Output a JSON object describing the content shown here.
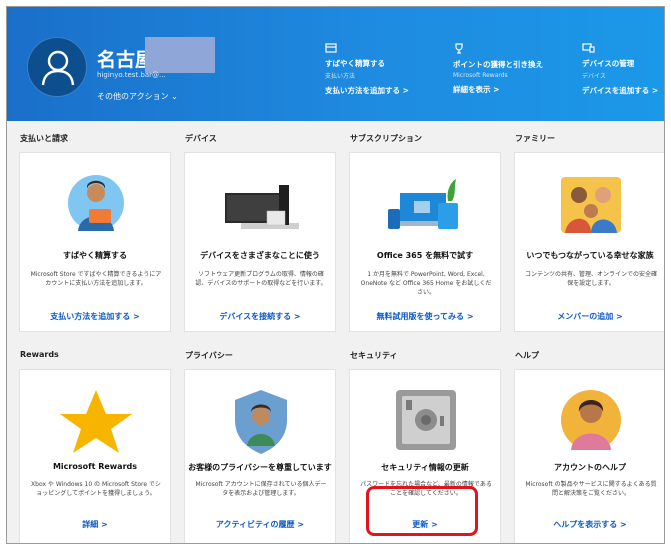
{
  "header": {
    "user_name": "名古屋",
    "user_email": "higinyo.test.bar@...",
    "other_actions": "その他のアクション ⌄",
    "quick_actions": [
      {
        "icon": "card-icon",
        "title": "すばやく精算する",
        "sub": "支払い方法",
        "link": "支払い方法を追加する >"
      },
      {
        "icon": "trophy-icon",
        "title": "ポイントの獲得と引き換え",
        "sub": "Microsoft Rewards",
        "link": "詳細を表示 >"
      },
      {
        "icon": "devices-icon",
        "title": "デバイスの管理",
        "sub": "デバイス",
        "link": "デバイスを追加する >"
      }
    ]
  },
  "sections": [
    {
      "label": "支払いと請求",
      "title": "すばやく精算する",
      "desc": "Microsoft Store ですばやく精算できるようにアカウントに支払い方法を追加します。",
      "link": "支払い方法を追加する >"
    },
    {
      "label": "デバイス",
      "title": "デバイスをさまざまなことに使う",
      "desc": "ソフトウェア更新プログラムの取得、情報の確認、デバイスのサポートの取得などを行います。",
      "link": "デバイスを接続する >"
    },
    {
      "label": "サブスクリプション",
      "title": "Office 365 を無料で試す",
      "desc": "1 か月を無料で PowerPoint, Word, Excel, OneNote など Office 365 Home をお試しください。",
      "link": "無料試用版を使ってみる >"
    },
    {
      "label": "ファミリー",
      "title": "いつでもつながっている幸せな家族",
      "desc": "コンテンツの共有、管理、オンラインでの安全確保を設定します。",
      "link": "メンバーの追加 >"
    },
    {
      "label": "Rewards",
      "title": "Microsoft Rewards",
      "desc": "Xbox や Windows 10 の Microsoft Store でショッピングしてポイントを獲得しましょう。",
      "link": "詳細 >"
    },
    {
      "label": "プライバシー",
      "title": "お客様のプライバシーを尊重しています",
      "desc": "Microsoft アカウントに保存されている個人データを表示および管理します。",
      "link": "アクティビティの履歴 >"
    },
    {
      "label": "セキュリティ",
      "title": "セキュリティ情報の更新",
      "desc": "パスワードを忘れた場合など、最新の情報であることを確認してください。",
      "link": "更新 >"
    },
    {
      "label": "ヘルプ",
      "title": "アカウントのヘルプ",
      "desc": "Microsoft の製品やサービスに関するよくある質問と解決策をご覧ください。",
      "link": "ヘルプを表示する >"
    }
  ],
  "colors": {
    "header_start": "#1a6fc9",
    "header_end": "#1c98e8",
    "link": "#0a58c8",
    "highlight": "#e0141c"
  }
}
